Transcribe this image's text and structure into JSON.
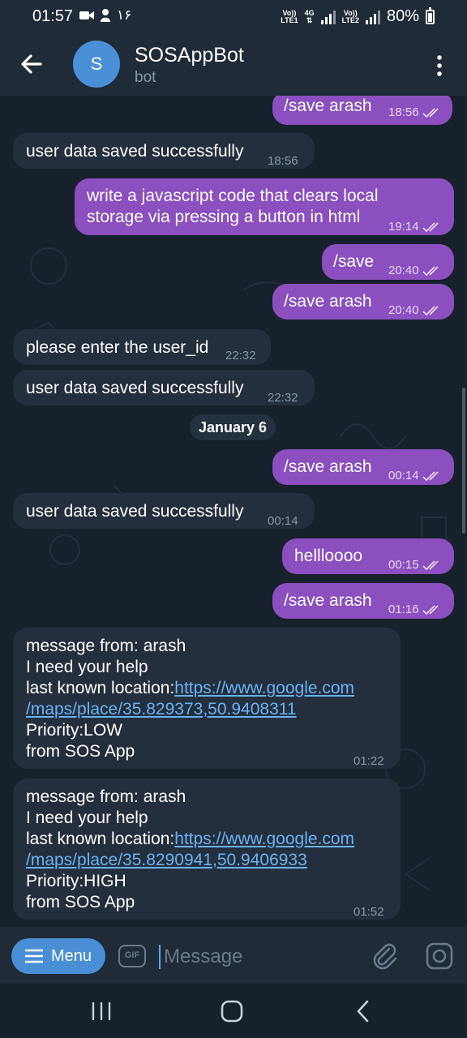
{
  "status_bar": {
    "time": "01:57",
    "extra": "۱۶",
    "sim1": "LTE1",
    "sim2": "LTE2",
    "volte": "Vo))",
    "net": "4G",
    "battery": "80%"
  },
  "header": {
    "avatar_letter": "S",
    "title": "SOSAppBot",
    "subtitle": "bot"
  },
  "date_separator": "January 6",
  "messages": [
    {
      "text": "/save arash",
      "time": "18:56"
    },
    {
      "text": "user data saved successfully",
      "time": "18:56"
    },
    {
      "text": "write a javascript code that clears local storage via pressing a button in html",
      "line1": "write a javascript code that clears local",
      "line2": "storage via pressing a button in html",
      "time": "19:14"
    },
    {
      "text": "/save",
      "time": "20:40"
    },
    {
      "text": "/save arash",
      "time": "20:40"
    },
    {
      "text": "please enter the user_id",
      "time": "22:32"
    },
    {
      "text": "user data saved successfully",
      "time": "22:32"
    },
    {
      "text": "/save arash",
      "time": "00:14"
    },
    {
      "text": "user data saved successfully",
      "time": "00:14"
    },
    {
      "text": "hellloooo",
      "time": "00:15"
    },
    {
      "text": "/save arash",
      "time": "01:16"
    },
    {
      "line1": "message from: arash",
      "line2": "I need your help",
      "label": "last known location:",
      "link1": "https://www.google.com",
      "link2": "/maps/place/35.829373,50.9408311",
      "priority": "Priority:LOW",
      "from": "from SOS App",
      "time": "01:22"
    },
    {
      "line1": "message from: arash",
      "line2": "I need your help",
      "label": "last known location:",
      "link1": "https://www.google.com",
      "link2": "/maps/place/35.8290941,50.9406933",
      "priority": "Priority:HIGH",
      "from": "from SOS App",
      "time": "01:52"
    }
  ],
  "input": {
    "menu_label": "Menu",
    "gif_label": "GIF",
    "placeholder": "Message"
  },
  "colors": {
    "outgoing_bubble": "#8b4fbf",
    "incoming_bubble": "#242f3d",
    "link": "#69b3f5",
    "menu_button": "#4a8fd6"
  }
}
